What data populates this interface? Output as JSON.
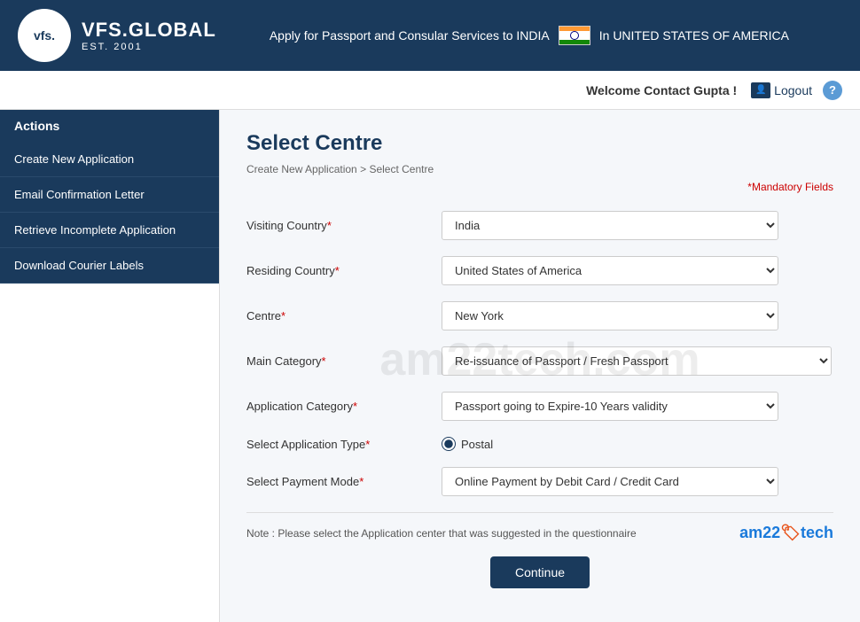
{
  "header": {
    "logo_vfs": "vfs.",
    "logo_subtitle": "VFS.GLOBAL",
    "logo_est": "EST. 2001",
    "tagline": "Apply for Passport and Consular Services to INDIA",
    "country": "In UNITED STATES OF AMERICA"
  },
  "subheader": {
    "welcome": "Welcome Contact Gupta !",
    "logout": "Logout",
    "help": "?"
  },
  "sidebar": {
    "header": "Actions",
    "items": [
      {
        "label": "Create New Application"
      },
      {
        "label": "Email Confirmation Letter"
      },
      {
        "label": "Retrieve Incomplete Application"
      },
      {
        "label": "Download Courier Labels"
      }
    ]
  },
  "page": {
    "title": "Select Centre",
    "breadcrumb_home": "Create New Application",
    "breadcrumb_separator": ">",
    "breadcrumb_current": "Select Centre",
    "mandatory_note": "*Mandatory Fields"
  },
  "form": {
    "visiting_country_label": "Visiting Country",
    "visiting_country_value": "India",
    "residing_country_label": "Residing Country",
    "residing_country_value": "United States of America",
    "centre_label": "Centre",
    "centre_value": "New York",
    "main_category_label": "Main Category",
    "main_category_value": "Re-issuance of Passport / Fresh Passport",
    "application_category_label": "Application Category",
    "application_category_value": "Passport going to Expire-10 Years validity",
    "select_app_type_label": "Select Application Type",
    "postal_label": "Postal",
    "select_payment_label": "Select Payment Mode",
    "payment_value": "Online Payment by Debit Card / Credit Card",
    "note": "Note : Please select the Application center that was suggested in the questionnaire",
    "continue_btn": "Continue"
  },
  "watermark": "am22tech.com"
}
